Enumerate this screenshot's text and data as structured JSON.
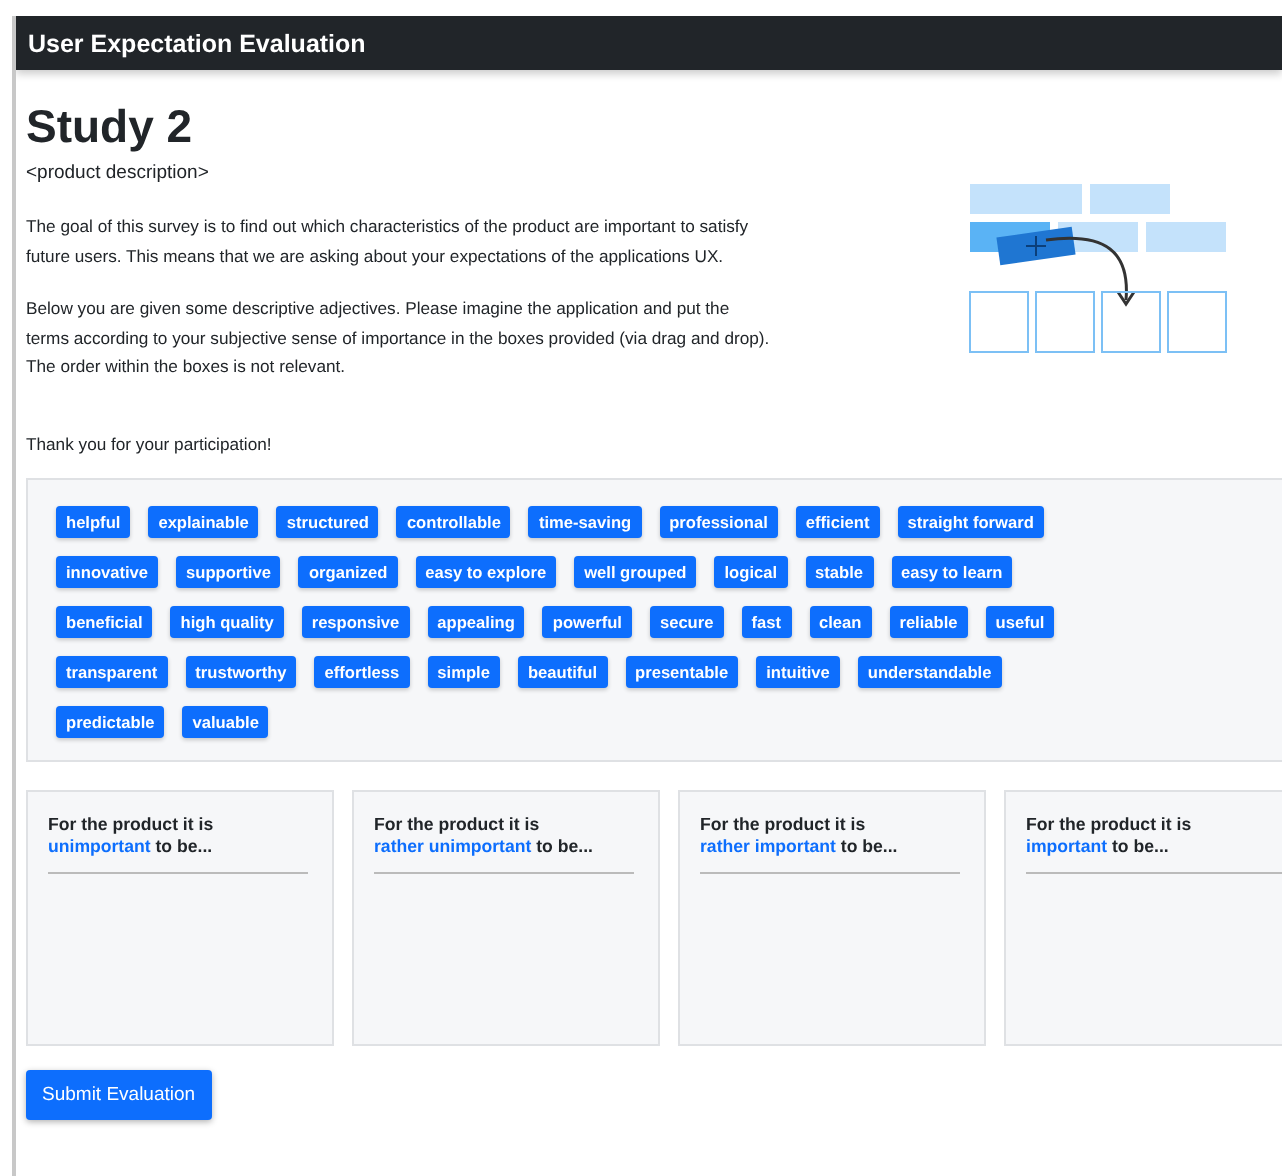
{
  "header": {
    "title": "User Expectation Evaluation"
  },
  "study": {
    "title": "Study 2",
    "description": "<product description>",
    "paragraphs": [
      "The goal of this survey is to find out which characteristics of the product are important to satisfy future users. This means that we are asking about your expectations of the applications UX.",
      "Below you are given some descriptive adjectives. Please imagine the application and put the terms according to your subjective sense of importance in the boxes provided (via drag and drop). The order within the boxes is not relevant."
    ],
    "thanks": "Thank you for your participation!"
  },
  "term_rows": [
    [
      "helpful",
      "explainable",
      "structured",
      "controllable",
      "time-saving",
      "professional",
      "efficient",
      "straight forward"
    ],
    [
      "innovative",
      "supportive",
      "organized",
      "easy to explore",
      "well grouped",
      "logical",
      "stable",
      "easy to learn"
    ],
    [
      "beneficial",
      "high quality",
      "responsive",
      "appealing",
      "powerful",
      "secure",
      "fast",
      "clean",
      "reliable",
      "useful"
    ],
    [
      "transparent",
      "trustworthy",
      "effortless",
      "simple",
      "beautiful",
      "presentable",
      "intuitive",
      "understandable"
    ],
    [
      "predictable",
      "valuable"
    ]
  ],
  "boxes": [
    {
      "prefix": "For the product it is",
      "level_text": "unimportant",
      "suffix": "to be..."
    },
    {
      "prefix": "For the product it is",
      "level_text": "rather unimportant",
      "suffix": "to be..."
    },
    {
      "prefix": "For the product it is",
      "level_text": "rather important",
      "suffix": "to be..."
    },
    {
      "prefix": "For the product it is",
      "level_text": "important",
      "suffix": "to be..."
    }
  ],
  "submit": "Submit Evaluation"
}
